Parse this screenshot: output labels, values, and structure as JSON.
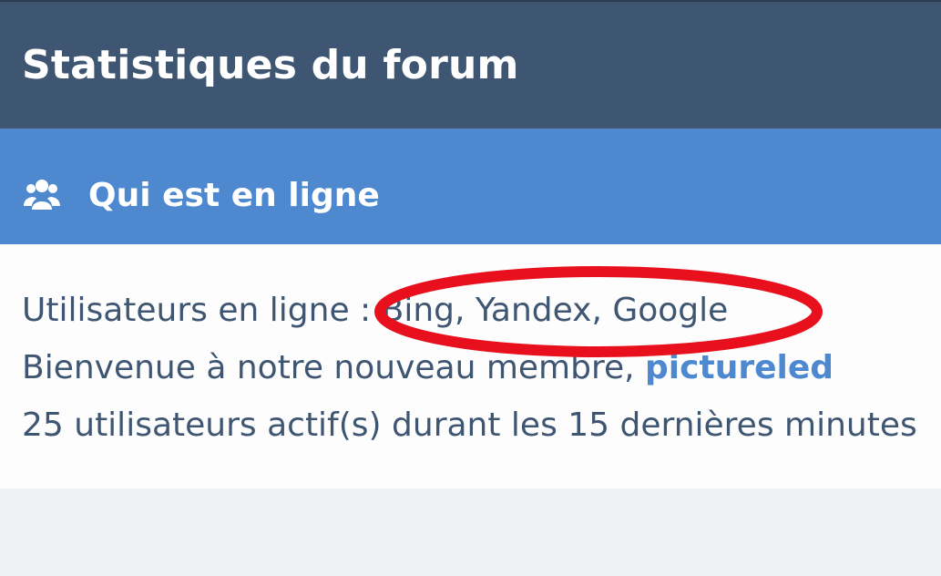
{
  "stats_panel": {
    "title": "Statistiques du forum"
  },
  "online_panel": {
    "icon": "users-icon",
    "title": "Qui est en ligne",
    "online_users_label": "Utilisateurs en ligne : ",
    "online_users_value": "Bing, Yandex, Google",
    "welcome_text": "Bienvenue à notre nouveau membre, ",
    "new_member_name": "pictureled",
    "active_users_text": "25 utilisateurs actif(s) durant les 15 dernières minutes"
  },
  "annotation": {
    "color": "#e8101c"
  },
  "colors": {
    "header_dark": "#3f5672",
    "header_blue": "#4e89d0",
    "text": "#3f5672",
    "background": "#eef0f4"
  }
}
